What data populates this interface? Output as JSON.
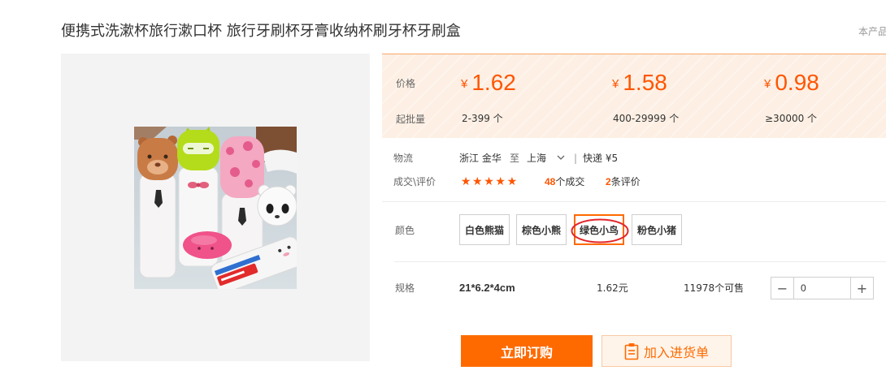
{
  "product": {
    "title": "便携式洗漱杯旅行漱口杯 旅行牙刷杯牙膏收纳杯刷牙杯牙刷盒",
    "side_note": "本产品"
  },
  "price_panel": {
    "price_label": "价格",
    "moq_label": "起批量",
    "currency": "¥",
    "tiers": [
      {
        "price": "1.62",
        "range": "2-399 个"
      },
      {
        "price": "1.58",
        "range": "400-29999 个"
      },
      {
        "price": "0.98",
        "range": "≥30000 个"
      }
    ]
  },
  "logistics": {
    "label": "物流",
    "from": "浙江 金华",
    "to_word": "至",
    "to": "上海",
    "separator": "|",
    "shipping": "快递 ¥5"
  },
  "reviews": {
    "label": "成交\\评价",
    "rating": 5,
    "rating_max": 5,
    "deals_count": "48",
    "deals_suffix": "个成交",
    "reviews_count": "2",
    "reviews_suffix": "条评价"
  },
  "color": {
    "label": "颜色",
    "selected_index": 2,
    "options": [
      {
        "label": "白色熊猫"
      },
      {
        "label": "棕色小熊"
      },
      {
        "label": "绿色小鸟"
      },
      {
        "label": "粉色小猪"
      }
    ]
  },
  "spec": {
    "label": "规格",
    "size": "21*6.2*4cm",
    "unit_price": "1.62元",
    "stock": "11978个可售",
    "minus": "−",
    "quantity": "0",
    "plus": "+"
  },
  "actions": {
    "buy_now": "立即订购",
    "add_to_list": "加入进货单"
  },
  "icons": {
    "dropdown": "chevron-down-icon",
    "rating": "star-icon",
    "add_to_list": "clipboard-icon"
  },
  "colors": {
    "accent": "#ff6a00",
    "price": "#ff5500",
    "panel_background": "#fdefe3",
    "selected_border": "#ff6a00",
    "annotation": "#e3262b"
  }
}
